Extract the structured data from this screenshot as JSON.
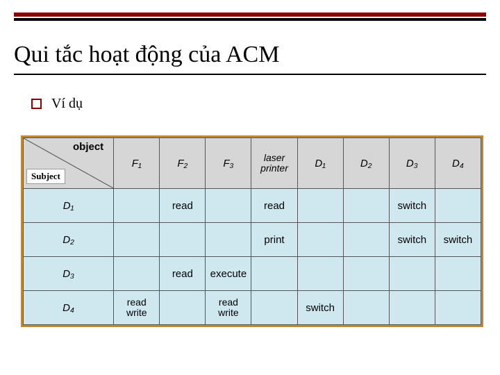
{
  "title": "Qui tắc hoạt động của ACM",
  "bullet": "Ví dụ",
  "corner": {
    "object": "object",
    "subject": "Subject"
  },
  "columns": [
    "F₁",
    "F₂",
    "F₃",
    "laser printer",
    "D₁",
    "D₂",
    "D₃",
    "D₄"
  ],
  "rows": [
    {
      "label": "D₁",
      "cells": [
        "",
        "read",
        "",
        "read",
        "",
        "",
        "switch",
        ""
      ]
    },
    {
      "label": "D₂",
      "cells": [
        "",
        "",
        "",
        "print",
        "",
        "",
        "switch",
        "switch"
      ]
    },
    {
      "label": "D₃",
      "cells": [
        "",
        "read",
        "execute",
        "",
        "",
        "",
        "",
        ""
      ]
    },
    {
      "label": "D₄",
      "cells": [
        "read write",
        "",
        "read write",
        "",
        "switch",
        "",
        "",
        ""
      ]
    }
  ]
}
